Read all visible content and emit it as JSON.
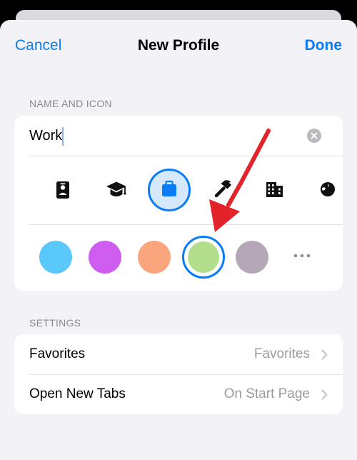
{
  "nav": {
    "cancel_label": "Cancel",
    "title": "New Profile",
    "done_label": "Done"
  },
  "name_and_icon": {
    "header": "NAME AND ICON",
    "name_value": "Work",
    "icons": [
      "person-badge-icon",
      "graduation-cap-icon",
      "briefcase-icon",
      "hammer-icon",
      "building-icon",
      "globe-icon"
    ],
    "selected_icon": "briefcase-icon",
    "colors": [
      "#5ac8fa",
      "#cf5ef0",
      "#fba57d",
      "#b3df8d",
      "#b5a6b8"
    ],
    "selected_color": "#b3df8d"
  },
  "settings": {
    "header": "SETTINGS",
    "rows": [
      {
        "label": "Favorites",
        "value": "Favorites"
      },
      {
        "label": "Open New Tabs",
        "value": "On Start Page"
      }
    ]
  },
  "annotation": {
    "arrow_color": "#e3232a"
  }
}
